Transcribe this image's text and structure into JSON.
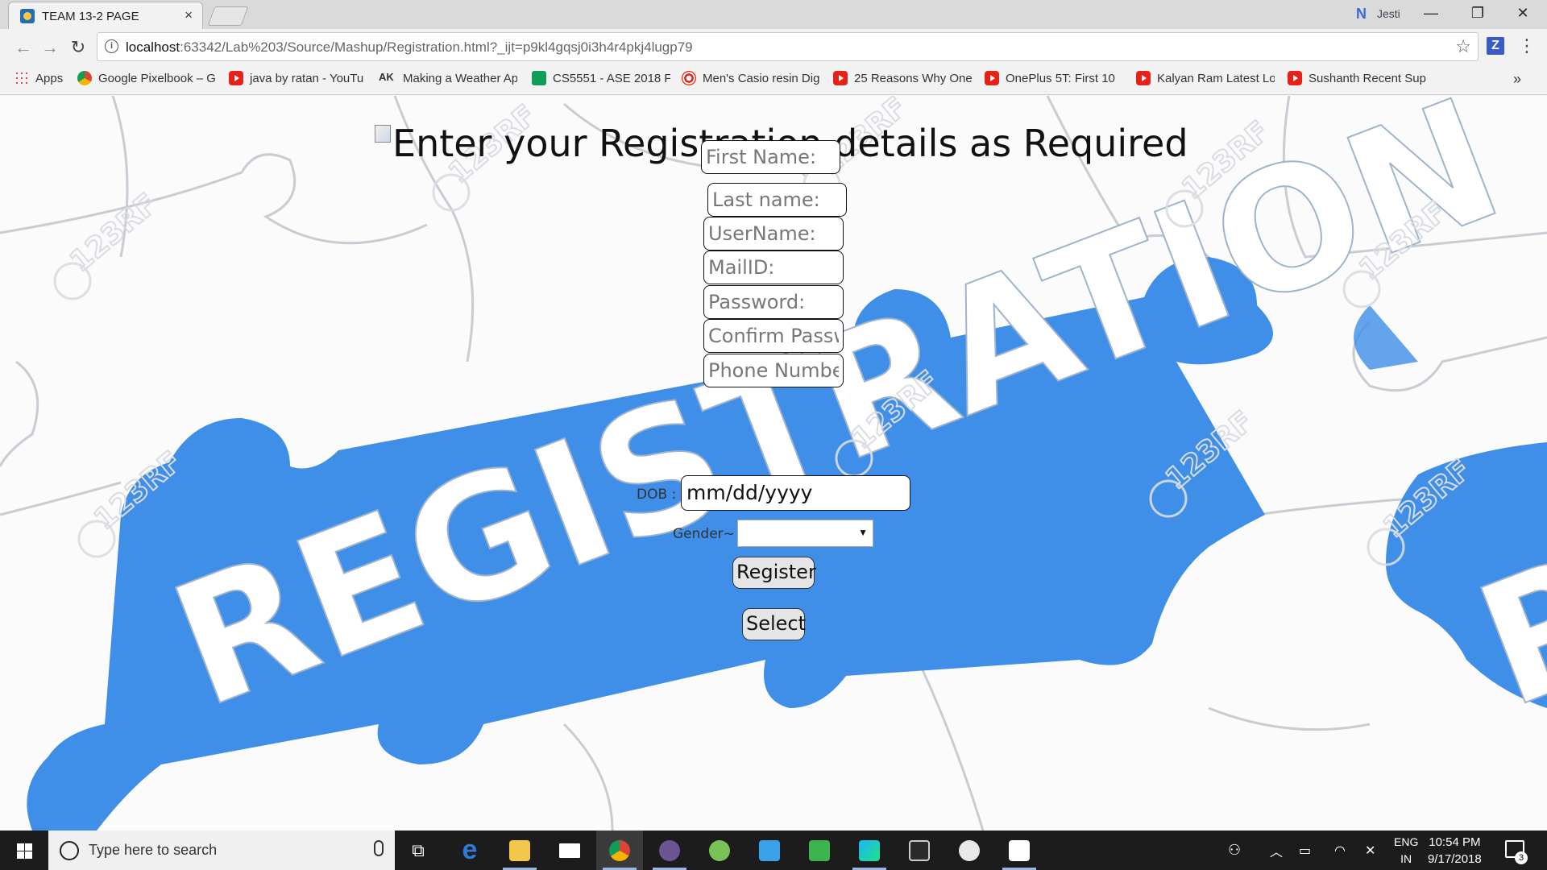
{
  "browser": {
    "tab_title": "TEAM 13-2 PAGE",
    "tab_close": "×",
    "profile_name": "Jesti",
    "url_host": "localhost",
    "url_path": ":63342/Lab%203/Source/Mashup/Registration.html?_ijt=p9kl4gqsj0i3h4r4pkj4lugp79",
    "ext_letter": "Z",
    "window_controls": {
      "minimize": "—",
      "maximize": "❐",
      "close": "✕"
    },
    "bookmarks": [
      {
        "label": "Apps",
        "icon": "apps-grid-icon"
      },
      {
        "label": "Google Pixelbook – G",
        "icon": "chrome-icon"
      },
      {
        "label": "java by ratan - YouTu",
        "icon": "youtube-icon"
      },
      {
        "label": "Making a Weather Ap",
        "icon": "ak-icon"
      },
      {
        "label": "CS5551 - ASE 2018 F",
        "icon": "sheets-icon"
      },
      {
        "label": "Men's Casio resin Dig",
        "icon": "target-icon"
      },
      {
        "label": "25 Reasons Why One",
        "icon": "youtube-icon"
      },
      {
        "label": "OnePlus 5T: First 10",
        "icon": "youtube-icon"
      },
      {
        "label": "Kalyan Ram Latest Lo",
        "icon": "youtube-icon"
      },
      {
        "label": "Sushanth Recent Sup",
        "icon": "youtube-icon"
      }
    ],
    "bookmarks_more": "»",
    "ak_text": "AK"
  },
  "page": {
    "title": "Enter your Registration details as Required",
    "background_text": "REGISTRATION",
    "watermark": "123RF",
    "fields": {
      "first_name": "First Name:",
      "last_name": "Last name:",
      "username": "UserName:",
      "mail": "MailID:",
      "password": "Password:",
      "confirm_password": "Confirm Passw",
      "phone": "Phone Number"
    },
    "dob_label": "DOB :",
    "dob_value": "mm/dd/yyyy",
    "gender_label": "Gender~",
    "gender_value": "",
    "register_button": "Register",
    "select_button": "Select",
    "accent_color": "#4a90e2"
  },
  "taskbar": {
    "search_placeholder": "Type here to search",
    "lang_top": "ENG",
    "lang_bottom": "IN",
    "time": "10:54 PM",
    "date": "9/17/2018",
    "notification_count": "3"
  }
}
